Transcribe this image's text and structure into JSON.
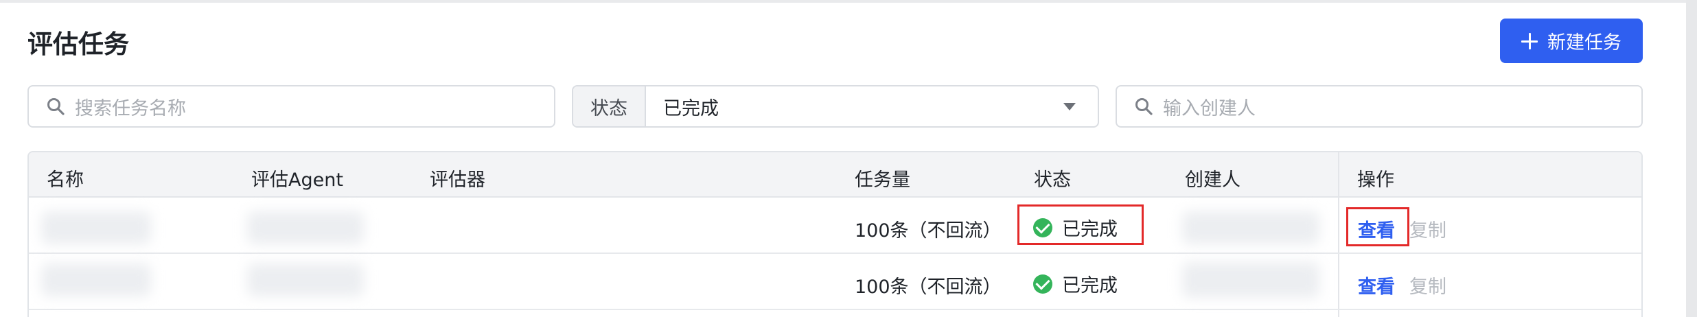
{
  "page": {
    "title": "评估任务"
  },
  "toolbar": {
    "new_task_label": "新建任务"
  },
  "filters": {
    "task_search_placeholder": "搜索任务名称",
    "status_label": "状态",
    "status_value": "已完成",
    "creator_placeholder": "输入创建人"
  },
  "table": {
    "columns": {
      "name": "名称",
      "agent": "评估Agent",
      "evaluator": "评估器",
      "amount": "任务量",
      "status": "状态",
      "creator": "创建人",
      "actions": "操作"
    },
    "rows": [
      {
        "amount": "100条（不回流）",
        "status": "已完成",
        "view": "查看",
        "copy": "复制"
      },
      {
        "amount": "100条（不回流）",
        "status": "已完成",
        "view": "查看",
        "copy": "复制"
      }
    ]
  },
  "colors": {
    "accent": "#2f5ff0",
    "success": "#34b45a",
    "highlight": "#e32929"
  },
  "icons": [
    "search-icon",
    "plus-icon",
    "caret-down-icon",
    "check-circle-icon"
  ]
}
